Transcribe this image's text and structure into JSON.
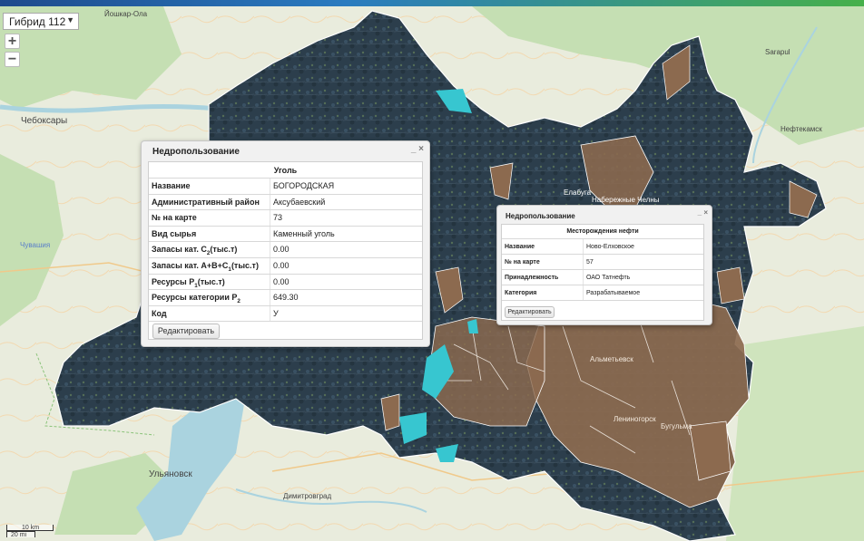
{
  "layer_select": {
    "value": "Гибрид 112"
  },
  "zoom": {
    "in_label": "+",
    "out_label": "−"
  },
  "scale": {
    "km": "10 km",
    "mi": "20 mi"
  },
  "map_labels": [
    "Йошкар-Ола",
    "Чебоксары",
    "Чувашия",
    "Ульяновск",
    "Димитровград",
    "Sarapul",
    "Нефтекамск",
    "Елабуга",
    "Лениногорск",
    "Альметьевск",
    "Бугульма",
    "Набережные Челны"
  ],
  "colors": {
    "region": "#2c3e4c",
    "oil_field": "#8c6a4f",
    "highlight": "#37c6d0",
    "land": "#e9ecdd",
    "forest": "#c5dfb3",
    "water": "#aad3df"
  },
  "popup1": {
    "title": "Недропользование",
    "controls": "_ ×",
    "header": "Уголь",
    "rows": [
      {
        "k": "Название",
        "v": "БОГОРОДСКАЯ"
      },
      {
        "k": "Административный район",
        "v": "Аксубаевский"
      },
      {
        "k": "№ на карте",
        "v": "73"
      },
      {
        "k": "Вид сырья",
        "v": "Каменный уголь"
      },
      {
        "k": "Запасы кат. C",
        "k_sub": "2",
        "k_tail": "(тыс.т)",
        "v": "0.00"
      },
      {
        "k": "Запасы кат. A+B+C",
        "k_sub": "1",
        "k_tail": "(тыс.т)",
        "v": "0.00"
      },
      {
        "k": "Ресурсы P",
        "k_sub": "1",
        "k_tail": "(тыс.т)",
        "v": "0.00"
      },
      {
        "k": "Ресурсы категории P",
        "k_sub": "2",
        "k_tail": "",
        "v": "649.30"
      },
      {
        "k": "Код",
        "v": "У"
      }
    ],
    "button": "Редактировать"
  },
  "popup2": {
    "title": "Недропользование",
    "controls": "_ ×",
    "header": "Месторождения нефти",
    "rows": [
      {
        "k": "Название",
        "v": "Ново-Елховское"
      },
      {
        "k": "№ на карте",
        "v": "57"
      },
      {
        "k": "Принадлежность",
        "v": "ОАО Татнефть"
      },
      {
        "k": "Категория",
        "v": "Разрабатываемое"
      }
    ],
    "button": "Редактировать"
  }
}
